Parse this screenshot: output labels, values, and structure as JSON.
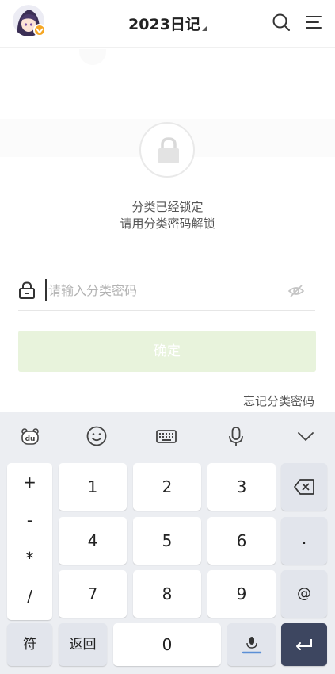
{
  "header": {
    "title": "2023日记",
    "icons": [
      "avatar",
      "vip-badge-icon",
      "search-icon",
      "menu-icon"
    ]
  },
  "lock": {
    "line1": "分类已经锁定",
    "line2": "请用分类密码解锁"
  },
  "password": {
    "placeholder": "请输入分类密码",
    "value": ""
  },
  "confirm_label": "确定",
  "forgot_label": "忘记分类密码",
  "keyboard": {
    "toolbar": [
      "baidu-icon",
      "emoji-icon",
      "keyboard-icon",
      "microphone-icon",
      "collapse-icon"
    ],
    "symbols": [
      "+",
      "-",
      "*",
      "/"
    ],
    "digits": [
      "1",
      "2",
      "3",
      "4",
      "5",
      "6",
      "7",
      "8",
      "9"
    ],
    "right_keys": [
      "backspace-icon",
      ".",
      "@"
    ],
    "bottom": {
      "sym": "符",
      "back": "返回",
      "zero": "0"
    }
  },
  "colors": {
    "confirm_bg": "#e8f3dc",
    "keyboard_bg": "#eceef2",
    "enter_key": "#3d4660",
    "vip_badge": "#f5a623"
  }
}
